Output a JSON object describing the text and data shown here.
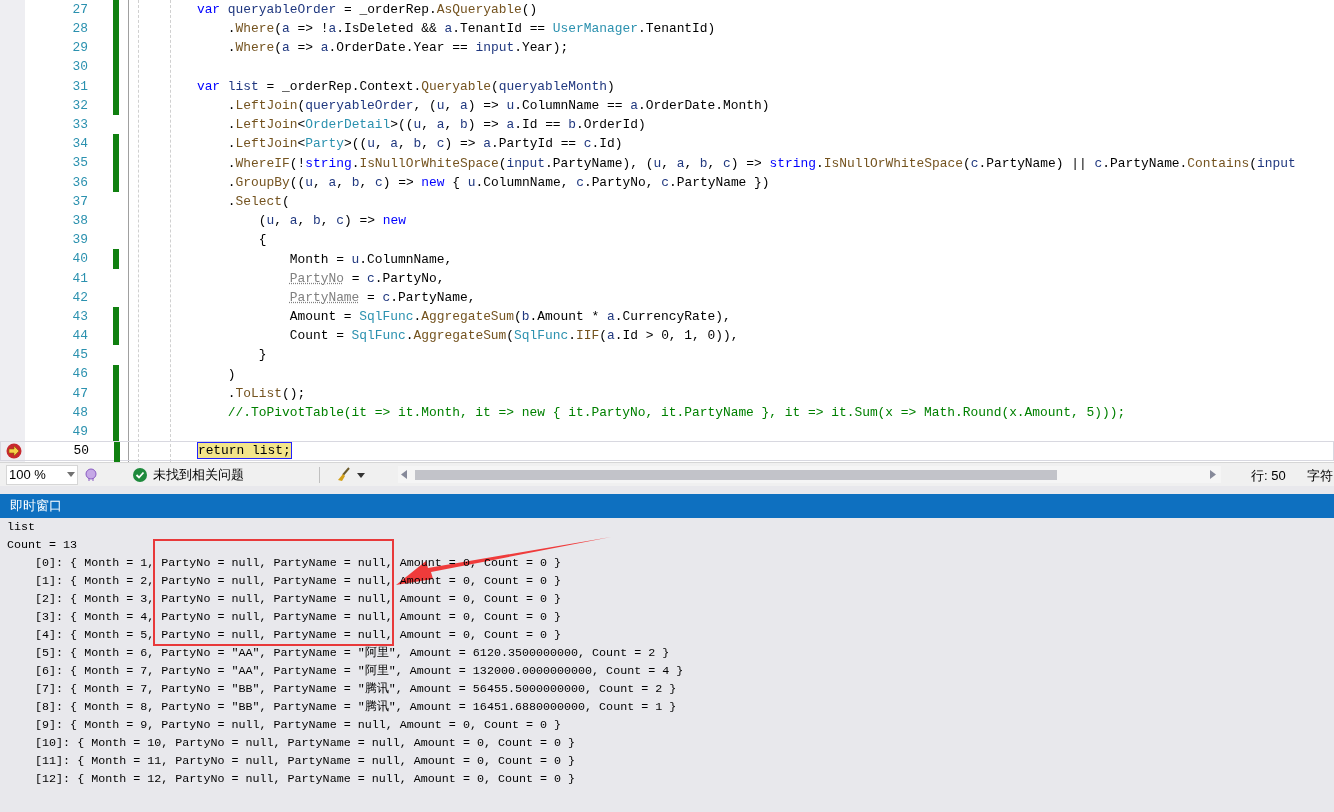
{
  "editor": {
    "lines": [
      {
        "number": "27",
        "changed": true,
        "current": false,
        "tokens": [
          {
            "kind": "keyword",
            "text": "        var"
          },
          {
            "kind": "local",
            "text": " queryableOrder"
          },
          {
            "kind": "plain",
            "text": " = _orderRep."
          },
          {
            "kind": "method",
            "text": "AsQueryable"
          },
          {
            "kind": "plain",
            "text": "()"
          }
        ]
      },
      {
        "number": "28",
        "changed": true,
        "current": false,
        "tokens": [
          {
            "kind": "plain",
            "text": "            ."
          },
          {
            "kind": "method",
            "text": "Where"
          },
          {
            "kind": "plain",
            "text": "("
          },
          {
            "kind": "local",
            "text": "a"
          },
          {
            "kind": "plain",
            "text": " => !"
          },
          {
            "kind": "local",
            "text": "a"
          },
          {
            "kind": "plain",
            "text": ".IsDeleted && "
          },
          {
            "kind": "local",
            "text": "a"
          },
          {
            "kind": "plain",
            "text": ".TenantId == "
          },
          {
            "kind": "type",
            "text": "UserManager"
          },
          {
            "kind": "plain",
            "text": ".TenantId)"
          }
        ]
      },
      {
        "number": "29",
        "changed": true,
        "current": false,
        "tokens": [
          {
            "kind": "plain",
            "text": "            ."
          },
          {
            "kind": "method",
            "text": "Where"
          },
          {
            "kind": "plain",
            "text": "("
          },
          {
            "kind": "local",
            "text": "a"
          },
          {
            "kind": "plain",
            "text": " => "
          },
          {
            "kind": "local",
            "text": "a"
          },
          {
            "kind": "plain",
            "text": ".OrderDate.Year == "
          },
          {
            "kind": "local",
            "text": "input"
          },
          {
            "kind": "plain",
            "text": ".Year);"
          }
        ]
      },
      {
        "number": "30",
        "changed": true,
        "current": false
      },
      {
        "number": "31",
        "changed": true,
        "current": false,
        "tokens": [
          {
            "kind": "keyword",
            "text": "        var"
          },
          {
            "kind": "local",
            "text": " list"
          },
          {
            "kind": "plain",
            "text": " = _orderRep.Context."
          },
          {
            "kind": "method",
            "text": "Queryable"
          },
          {
            "kind": "plain",
            "text": "("
          },
          {
            "kind": "local",
            "text": "queryableMonth"
          },
          {
            "kind": "plain",
            "text": ")"
          }
        ]
      },
      {
        "number": "32",
        "changed": true,
        "current": false,
        "tokens": [
          {
            "kind": "plain",
            "text": "            ."
          },
          {
            "kind": "method",
            "text": "LeftJoin"
          },
          {
            "kind": "plain",
            "text": "("
          },
          {
            "kind": "local",
            "text": "queryableOrder"
          },
          {
            "kind": "plain",
            "text": ", ("
          },
          {
            "kind": "local",
            "text": "u"
          },
          {
            "kind": "plain",
            "text": ", "
          },
          {
            "kind": "local",
            "text": "a"
          },
          {
            "kind": "plain",
            "text": ") => "
          },
          {
            "kind": "local",
            "text": "u"
          },
          {
            "kind": "plain",
            "text": ".ColumnName == "
          },
          {
            "kind": "local",
            "text": "a"
          },
          {
            "kind": "plain",
            "text": ".OrderDate.Month)"
          }
        ]
      },
      {
        "number": "33",
        "changed": false,
        "current": false,
        "tokens": [
          {
            "kind": "plain",
            "text": "            ."
          },
          {
            "kind": "method",
            "text": "LeftJoin"
          },
          {
            "kind": "plain",
            "text": "<"
          },
          {
            "kind": "type",
            "text": "OrderDetail"
          },
          {
            "kind": "plain",
            "text": ">(("
          },
          {
            "kind": "local",
            "text": "u"
          },
          {
            "kind": "plain",
            "text": ", "
          },
          {
            "kind": "local",
            "text": "a"
          },
          {
            "kind": "plain",
            "text": ", "
          },
          {
            "kind": "local",
            "text": "b"
          },
          {
            "kind": "plain",
            "text": ") => "
          },
          {
            "kind": "local",
            "text": "a"
          },
          {
            "kind": "plain",
            "text": ".Id == "
          },
          {
            "kind": "local",
            "text": "b"
          },
          {
            "kind": "plain",
            "text": ".OrderId)"
          }
        ]
      },
      {
        "number": "34",
        "changed": true,
        "current": false,
        "tokens": [
          {
            "kind": "plain",
            "text": "            ."
          },
          {
            "kind": "method",
            "text": "LeftJoin"
          },
          {
            "kind": "plain",
            "text": "<"
          },
          {
            "kind": "type",
            "text": "Party"
          },
          {
            "kind": "plain",
            "text": ">(("
          },
          {
            "kind": "local",
            "text": "u"
          },
          {
            "kind": "plain",
            "text": ", "
          },
          {
            "kind": "local",
            "text": "a"
          },
          {
            "kind": "plain",
            "text": ", "
          },
          {
            "kind": "local",
            "text": "b"
          },
          {
            "kind": "plain",
            "text": ", "
          },
          {
            "kind": "local",
            "text": "c"
          },
          {
            "kind": "plain",
            "text": ") => "
          },
          {
            "kind": "local",
            "text": "a"
          },
          {
            "kind": "plain",
            "text": ".PartyId == "
          },
          {
            "kind": "local",
            "text": "c"
          },
          {
            "kind": "plain",
            "text": ".Id)"
          }
        ]
      },
      {
        "number": "35",
        "changed": true,
        "current": false,
        "tokens": [
          {
            "kind": "plain",
            "text": "            ."
          },
          {
            "kind": "method",
            "text": "WhereIF"
          },
          {
            "kind": "plain",
            "text": "(!"
          },
          {
            "kind": "keyword",
            "text": "string"
          },
          {
            "kind": "plain",
            "text": "."
          },
          {
            "kind": "method",
            "text": "IsNullOrWhiteSpace"
          },
          {
            "kind": "plain",
            "text": "("
          },
          {
            "kind": "local",
            "text": "input"
          },
          {
            "kind": "plain",
            "text": ".PartyName), ("
          },
          {
            "kind": "local",
            "text": "u"
          },
          {
            "kind": "plain",
            "text": ", "
          },
          {
            "kind": "local",
            "text": "a"
          },
          {
            "kind": "plain",
            "text": ", "
          },
          {
            "kind": "local",
            "text": "b"
          },
          {
            "kind": "plain",
            "text": ", "
          },
          {
            "kind": "local",
            "text": "c"
          },
          {
            "kind": "plain",
            "text": ") => "
          },
          {
            "kind": "keyword",
            "text": "string"
          },
          {
            "kind": "plain",
            "text": "."
          },
          {
            "kind": "method",
            "text": "IsNullOrWhiteSpace"
          },
          {
            "kind": "plain",
            "text": "("
          },
          {
            "kind": "local",
            "text": "c"
          },
          {
            "kind": "plain",
            "text": ".PartyName) || "
          },
          {
            "kind": "local",
            "text": "c"
          },
          {
            "kind": "plain",
            "text": ".PartyName."
          },
          {
            "kind": "method",
            "text": "Contains"
          },
          {
            "kind": "plain",
            "text": "("
          },
          {
            "kind": "local",
            "text": "input"
          }
        ]
      },
      {
        "number": "36",
        "changed": true,
        "current": false,
        "tokens": [
          {
            "kind": "plain",
            "text": "            ."
          },
          {
            "kind": "method",
            "text": "GroupBy"
          },
          {
            "kind": "plain",
            "text": "(("
          },
          {
            "kind": "local",
            "text": "u"
          },
          {
            "kind": "plain",
            "text": ", "
          },
          {
            "kind": "local",
            "text": "a"
          },
          {
            "kind": "plain",
            "text": ", "
          },
          {
            "kind": "local",
            "text": "b"
          },
          {
            "kind": "plain",
            "text": ", "
          },
          {
            "kind": "local",
            "text": "c"
          },
          {
            "kind": "plain",
            "text": ") => "
          },
          {
            "kind": "keyword",
            "text": "new"
          },
          {
            "kind": "plain",
            "text": " { "
          },
          {
            "kind": "local",
            "text": "u"
          },
          {
            "kind": "plain",
            "text": ".ColumnName, "
          },
          {
            "kind": "local",
            "text": "c"
          },
          {
            "kind": "plain",
            "text": ".PartyNo, "
          },
          {
            "kind": "local",
            "text": "c"
          },
          {
            "kind": "plain",
            "text": ".PartyName })"
          }
        ]
      },
      {
        "number": "37",
        "changed": false,
        "current": false,
        "tokens": [
          {
            "kind": "plain",
            "text": "            ."
          },
          {
            "kind": "method",
            "text": "Select"
          },
          {
            "kind": "plain",
            "text": "("
          }
        ]
      },
      {
        "number": "38",
        "changed": false,
        "current": false,
        "tokens": [
          {
            "kind": "plain",
            "text": "                ("
          },
          {
            "kind": "local",
            "text": "u"
          },
          {
            "kind": "plain",
            "text": ", "
          },
          {
            "kind": "local",
            "text": "a"
          },
          {
            "kind": "plain",
            "text": ", "
          },
          {
            "kind": "local",
            "text": "b"
          },
          {
            "kind": "plain",
            "text": ", "
          },
          {
            "kind": "local",
            "text": "c"
          },
          {
            "kind": "plain",
            "text": ") => "
          },
          {
            "kind": "keyword",
            "text": "new"
          }
        ]
      },
      {
        "number": "39",
        "changed": false,
        "current": false,
        "tokens": [
          {
            "kind": "plain",
            "text": "                {"
          }
        ]
      },
      {
        "number": "40",
        "changed": true,
        "current": false,
        "tokens": [
          {
            "kind": "plain",
            "text": "                    Month = "
          },
          {
            "kind": "local",
            "text": "u"
          },
          {
            "kind": "plain",
            "text": ".ColumnName,"
          }
        ]
      },
      {
        "number": "41",
        "changed": false,
        "current": false,
        "tokens": [
          {
            "kind": "dim",
            "text": "                    PartyNo"
          },
          {
            "kind": "plain",
            "text": " = "
          },
          {
            "kind": "local",
            "text": "c"
          },
          {
            "kind": "plain",
            "text": ".PartyNo,"
          }
        ]
      },
      {
        "number": "42",
        "changed": false,
        "current": false,
        "tokens": [
          {
            "kind": "dim",
            "text": "                    PartyName"
          },
          {
            "kind": "plain",
            "text": " = "
          },
          {
            "kind": "local",
            "text": "c"
          },
          {
            "kind": "plain",
            "text": ".PartyName,"
          }
        ]
      },
      {
        "number": "43",
        "changed": true,
        "current": false,
        "tokens": [
          {
            "kind": "plain",
            "text": "                    Amount = "
          },
          {
            "kind": "type",
            "text": "SqlFunc"
          },
          {
            "kind": "plain",
            "text": "."
          },
          {
            "kind": "method",
            "text": "AggregateSum"
          },
          {
            "kind": "plain",
            "text": "("
          },
          {
            "kind": "local",
            "text": "b"
          },
          {
            "kind": "plain",
            "text": ".Amount * "
          },
          {
            "kind": "local",
            "text": "a"
          },
          {
            "kind": "plain",
            "text": ".CurrencyRate),"
          }
        ]
      },
      {
        "number": "44",
        "changed": true,
        "current": false,
        "tokens": [
          {
            "kind": "plain",
            "text": "                    Count = "
          },
          {
            "kind": "type",
            "text": "SqlFunc"
          },
          {
            "kind": "plain",
            "text": "."
          },
          {
            "kind": "method",
            "text": "AggregateSum"
          },
          {
            "kind": "plain",
            "text": "("
          },
          {
            "kind": "type",
            "text": "SqlFunc"
          },
          {
            "kind": "plain",
            "text": "."
          },
          {
            "kind": "method",
            "text": "IIF"
          },
          {
            "kind": "plain",
            "text": "("
          },
          {
            "kind": "local",
            "text": "a"
          },
          {
            "kind": "plain",
            "text": ".Id > 0, 1, 0)),"
          }
        ]
      },
      {
        "number": "45",
        "changed": false,
        "current": false,
        "tokens": [
          {
            "kind": "plain",
            "text": "                }"
          }
        ]
      },
      {
        "number": "46",
        "changed": true,
        "current": false,
        "tokens": [
          {
            "kind": "plain",
            "text": "            )"
          }
        ]
      },
      {
        "number": "47",
        "changed": true,
        "current": false,
        "tokens": [
          {
            "kind": "plain",
            "text": "            ."
          },
          {
            "kind": "method",
            "text": "ToList"
          },
          {
            "kind": "plain",
            "text": "();"
          }
        ]
      },
      {
        "number": "48",
        "changed": true,
        "current": false,
        "tokens": [
          {
            "kind": "comment",
            "text": "            //.ToPivotTable(it => it.Month, it => new { it.PartyNo, it.PartyName }, it => it.Sum(x => Math.Round(x.Amount, 5)));"
          }
        ]
      },
      {
        "number": "49",
        "changed": true,
        "current": false
      },
      {
        "number": "50",
        "changed": true,
        "current": true,
        "tokens": [
          {
            "kind": "statement",
            "text": "        return list;"
          }
        ]
      }
    ]
  },
  "status_bar": {
    "zoom": "100 %",
    "issues": "未找到相关问题",
    "line": "行: 50",
    "column": "字符"
  },
  "immediate_window": {
    "title": "即时窗口",
    "output": [
      "list",
      "Count = 13",
      "    [0]: { Month = 1, PartyNo = null, PartyName = null, Amount = 0, Count = 0 }",
      "    [1]: { Month = 2, PartyNo = null, PartyName = null, Amount = 0, Count = 0 }",
      "    [2]: { Month = 3, PartyNo = null, PartyName = null, Amount = 0, Count = 0 }",
      "    [3]: { Month = 4, PartyNo = null, PartyName = null, Amount = 0, Count = 0 }",
      "    [4]: { Month = 5, PartyNo = null, PartyName = null, Amount = 0, Count = 0 }",
      "    [5]: { Month = 6, PartyNo = \"AA\", PartyName = \"阿里\", Amount = 6120.3500000000, Count = 2 }",
      "    [6]: { Month = 7, PartyNo = \"AA\", PartyName = \"阿里\", Amount = 132000.0000000000, Count = 4 }",
      "    [7]: { Month = 7, PartyNo = \"BB\", PartyName = \"腾讯\", Amount = 56455.5000000000, Count = 2 }",
      "    [8]: { Month = 8, PartyNo = \"BB\", PartyName = \"腾讯\", Amount = 16451.6880000000, Count = 1 }",
      "    [9]: { Month = 9, PartyNo = null, PartyName = null, Amount = 0, Count = 0 }",
      "    [10]: { Month = 10, PartyNo = null, PartyName = null, Amount = 0, Count = 0 }",
      "    [11]: { Month = 11, PartyNo = null, PartyName = null, Amount = 0, Count = 0 }",
      "    [12]: { Month = 12, PartyNo = null, PartyName = null, Amount = 0, Count = 0 }"
    ]
  }
}
